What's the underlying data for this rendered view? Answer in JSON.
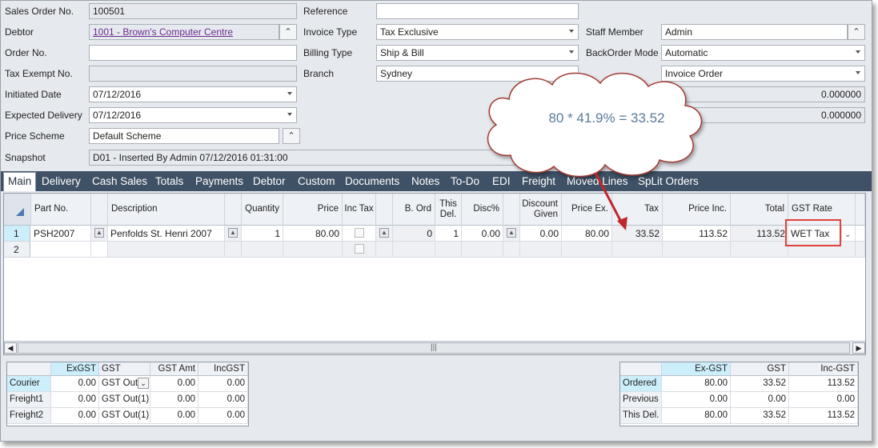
{
  "header": {
    "sales_order_label": "Sales Order No.",
    "sales_order_value": "100501",
    "debtor_label": "Debtor",
    "debtor_value": "1001 - Brown's Computer Centre",
    "order_no_label": "Order No.",
    "order_no_value": "",
    "tax_exempt_label": "Tax Exempt No.",
    "tax_exempt_value": "",
    "initiated_label": "Initiated Date",
    "initiated_value": "07/12/2016",
    "expected_label": "Expected Delivery",
    "expected_value": "07/12/2016",
    "price_scheme_label": "Price Scheme",
    "price_scheme_value": "Default Scheme",
    "snapshot_label": "Snapshot",
    "snapshot_value": "D01 - Inserted By Admin 07/12/2016 01:31:00",
    "reference_label": "Reference",
    "reference_value": "",
    "invoice_type_label": "Invoice Type",
    "invoice_type_value": "Tax Exclusive",
    "billing_type_label": "Billing Type",
    "billing_type_value": "Ship & Bill",
    "branch_label": "Branch",
    "branch_value": "Sydney",
    "staff_label": "Staff Member",
    "staff_value": "Admin",
    "backorder_label": "BackOrder Mode",
    "backorder_value": "Automatic",
    "invoice_order_value": "Invoice Order",
    "rate1_value": "0.000000",
    "rate2_value": "0.000000"
  },
  "callout": {
    "text": "80 * 41.9% = 33.52"
  },
  "tabs": [
    "Main",
    "Delivery",
    "Cash Sales",
    "Totals",
    "Payments",
    "Debtor",
    "Custom",
    "Documents",
    "Notes",
    "To-Do",
    "EDI",
    "Freight",
    "Moved Lines",
    "SpLit Orders"
  ],
  "grid": {
    "columns": [
      "Part No.",
      "Description",
      "Quantity",
      "Price",
      "Inc Tax",
      "B. Ord",
      "This Del.",
      "Disc%",
      "Discount Given",
      "Price Ex.",
      "Tax",
      "Price Inc.",
      "Total",
      "GST Rate"
    ],
    "rows": [
      {
        "num": "1",
        "part": "PSH2007",
        "desc": "Penfolds St. Henri 2007",
        "qty": "1",
        "price": "80.00",
        "bord": "0",
        "thisdel": "1",
        "disc": "0.00",
        "discgiven": "0.00",
        "priceex": "80.00",
        "tax": "33.52",
        "priceinc": "113.52",
        "total": "113.52",
        "gst": "WET Tax"
      },
      {
        "num": "2",
        "part": "",
        "desc": "",
        "qty": "",
        "price": "",
        "bord": "",
        "thisdel": "",
        "disc": "",
        "discgiven": "",
        "priceex": "",
        "tax": "",
        "priceinc": "",
        "total": "",
        "gst": ""
      }
    ]
  },
  "freight": {
    "headers": [
      "ExGST",
      "GST",
      "GST Amt",
      "IncGST"
    ],
    "rows": [
      {
        "label": "Courier",
        "exgst": "0.00",
        "gst": "GST Out",
        "gstamt": "0.00",
        "incgst": "0.00"
      },
      {
        "label": "Freight1",
        "exgst": "0.00",
        "gst": "GST Out(1)",
        "gstamt": "0.00",
        "incgst": "0.00"
      },
      {
        "label": "Freight2",
        "exgst": "0.00",
        "gst": "GST Out(1)",
        "gstamt": "0.00",
        "incgst": "0.00"
      }
    ]
  },
  "totals": {
    "headers": [
      "Ex-GST",
      "GST",
      "Inc-GST"
    ],
    "rows": [
      {
        "label": "Ordered",
        "exgst": "80.00",
        "gst": "33.52",
        "incgst": "113.52"
      },
      {
        "label": "Previous",
        "exgst": "0.00",
        "gst": "0.00",
        "incgst": "0.00"
      },
      {
        "label": "This Del.",
        "exgst": "80.00",
        "gst": "33.52",
        "incgst": "113.52"
      }
    ]
  },
  "colors": {
    "tab_bar": "#3f5166",
    "highlight_box": "#e0413a",
    "callout_arrow": "#c1272d",
    "callout_text": "#5a7a9a"
  }
}
